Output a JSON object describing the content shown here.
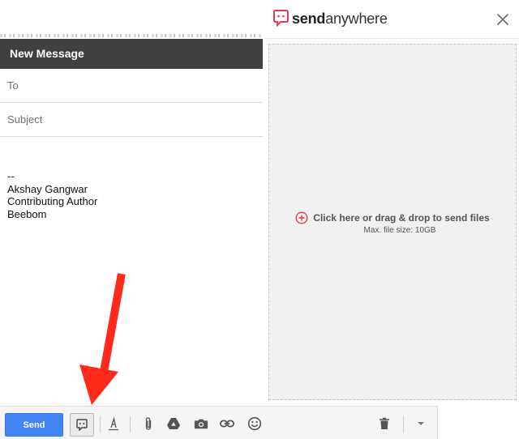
{
  "compose": {
    "header_title": "New Message",
    "to_placeholder": "To",
    "subject_placeholder": "Subject",
    "signature": [
      "--",
      "Akshay Gangwar",
      "Contributing Author",
      "Beebom"
    ]
  },
  "sendanywhere": {
    "brand_prefix": "send",
    "brand_suffix": "anywhere",
    "brand_color": "#e8394d",
    "drop_prompt": "Click here or drag & drop to send files",
    "max_size": "Max. file size: 10GB",
    "close_icon": "close-icon"
  },
  "toolbar": {
    "send_label": "Send",
    "send_color": "#4285f4",
    "icons": [
      "sendanywhere-icon",
      "formatting-icon",
      "attach-icon",
      "drive-icon",
      "photo-icon",
      "link-icon",
      "emoji-icon",
      "trash-icon",
      "more-options-icon"
    ]
  },
  "annotation": {
    "arrow_color": "#ff2a1a"
  }
}
